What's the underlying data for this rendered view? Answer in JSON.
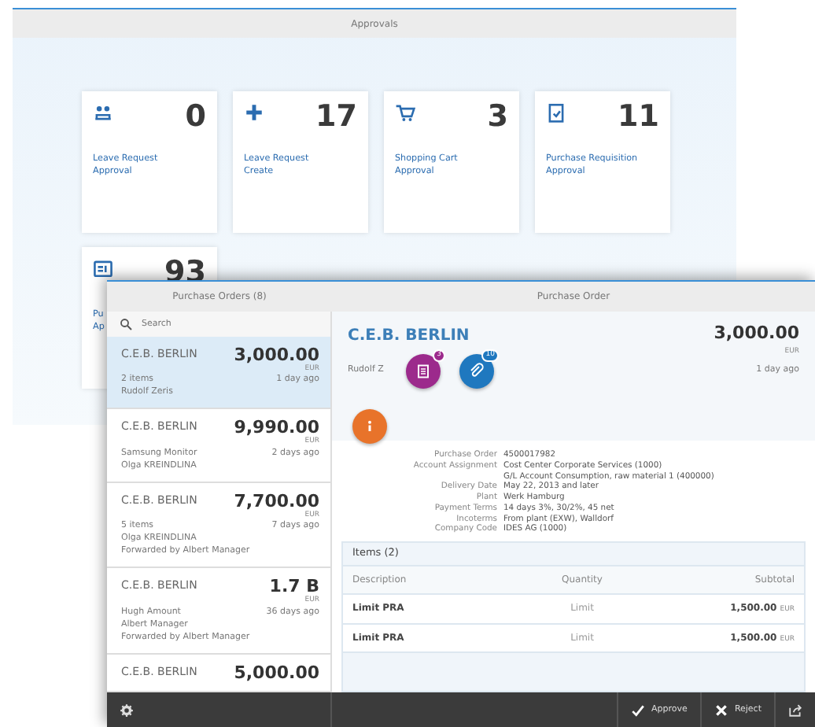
{
  "launchpad": {
    "title": "Approvals",
    "tiles": [
      {
        "kind": "people",
        "count": "0",
        "title": [
          "Leave Request",
          "Approval"
        ]
      },
      {
        "kind": "plus",
        "count": "17",
        "title": [
          "Leave Request",
          "Create"
        ]
      },
      {
        "kind": "cart",
        "count": "3",
        "title": [
          "Shopping Cart",
          "Approval"
        ]
      },
      {
        "kind": "clipboard",
        "count": "11",
        "title": [
          "Purchase Requisition",
          "Approval"
        ]
      },
      {
        "kind": "document",
        "count": "93",
        "title": [
          "Pu",
          "Ap"
        ]
      }
    ]
  },
  "orders_window": {
    "master": {
      "title": "Purchase Orders (8)",
      "search": {
        "placeholder": "Search"
      },
      "items": [
        {
          "vendor": "C.E.B. BERLIN",
          "amount": "3,000.00",
          "currency": "EUR",
          "age": "1 day ago",
          "lines": [
            "2 items",
            "Rudolf Zeris"
          ],
          "selected": true
        },
        {
          "vendor": "C.E.B. BERLIN",
          "amount": "9,990.00",
          "currency": "EUR",
          "age": "2 days ago",
          "lines": [
            "Samsung Monitor",
            "Olga KREINDLINA"
          ],
          "selected": false
        },
        {
          "vendor": "C.E.B. BERLIN",
          "amount": "7,700.00",
          "currency": "EUR",
          "age": "7 days ago",
          "lines": [
            "5 items",
            "Olga KREINDLINA",
            "Forwarded by Albert Manager"
          ],
          "selected": false
        },
        {
          "vendor": "C.E.B. BERLIN",
          "amount": "1.7 B",
          "currency": "EUR",
          "age": "36 days ago",
          "lines": [
            "Hugh Amount",
            "Albert Manager",
            "Forwarded by Albert Manager"
          ],
          "selected": false
        },
        {
          "vendor": "C.E.B. BERLIN",
          "amount": "5,000.00",
          "selected": false
        }
      ]
    },
    "detail": {
      "title": "Purchase Order",
      "header": {
        "vendor": "C.E.B. BERLIN",
        "amount": "3,000.00",
        "currency": "EUR",
        "person": "Rudolf Z",
        "age": "1 day ago"
      },
      "icon_tabs": [
        {
          "kind": "notes",
          "badge": "3",
          "color": "#9c2a8c"
        },
        {
          "kind": "attachments",
          "badge": "10",
          "color": "#1f78bf"
        },
        {
          "kind": "info",
          "color": "#e8732a"
        }
      ],
      "fields": [
        {
          "label": "Purchase Order",
          "value": [
            "4500017982"
          ]
        },
        {
          "label": "Account Assignment",
          "value": [
            "Cost Center Corporate Services (1000)",
            "G/L Account Consumption, raw material 1 (400000)"
          ]
        },
        {
          "label": "Delivery Date",
          "value": [
            "May 22, 2013 and later"
          ]
        },
        {
          "label": "Plant",
          "value": [
            "Werk Hamburg"
          ]
        },
        {
          "label": "Payment Terms",
          "value": [
            "14 days 3%, 30/2%, 45 net"
          ]
        },
        {
          "label": "Incoterms",
          "value": [
            "From plant (EXW), Walldorf"
          ]
        },
        {
          "label": "Company Code",
          "value": [
            "IDES AG (1000)"
          ]
        }
      ],
      "items": {
        "title": "Items (2)",
        "columns": [
          "Description",
          "Quantity",
          "Subtotal"
        ],
        "rows": [
          {
            "description": "Limit PRA",
            "quantity": "Limit",
            "subtotal": "1,500.00",
            "currency": "EUR"
          },
          {
            "description": "Limit PRA",
            "quantity": "Limit",
            "subtotal": "1,500.00",
            "currency": "EUR"
          }
        ]
      }
    },
    "footer": {
      "actions": [
        {
          "kind": "approve",
          "label": "Approve"
        },
        {
          "kind": "reject",
          "label": "Reject"
        },
        {
          "kind": "share"
        }
      ]
    }
  }
}
